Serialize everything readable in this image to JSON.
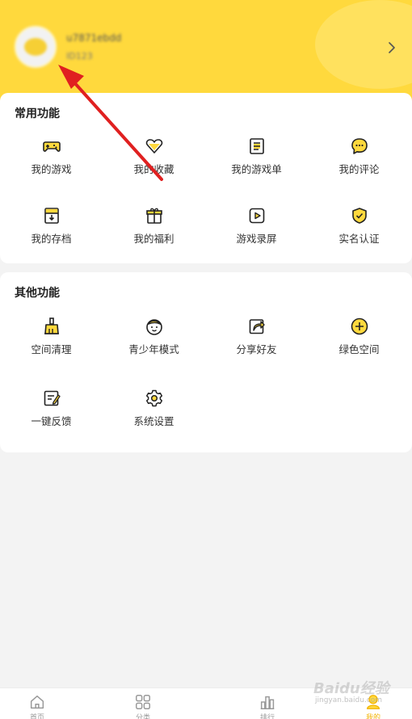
{
  "profile": {
    "username": "u7871ebdd",
    "sublabel": "ID123"
  },
  "sections": [
    {
      "title": "常用功能",
      "items": [
        {
          "label": "我的游戏",
          "icon": "gamepad-icon"
        },
        {
          "label": "我的收藏",
          "icon": "heart-icon"
        },
        {
          "label": "我的游戏单",
          "icon": "list-icon"
        },
        {
          "label": "我的评论",
          "icon": "comment-icon"
        },
        {
          "label": "我的存档",
          "icon": "archive-icon"
        },
        {
          "label": "我的福利",
          "icon": "gift-icon"
        },
        {
          "label": "游戏录屏",
          "icon": "record-icon"
        },
        {
          "label": "实名认证",
          "icon": "shield-check-icon"
        }
      ]
    },
    {
      "title": "其他功能",
      "items": [
        {
          "label": "空间清理",
          "icon": "broom-icon"
        },
        {
          "label": "青少年模式",
          "icon": "kid-face-icon"
        },
        {
          "label": "分享好友",
          "icon": "share-icon"
        },
        {
          "label": "绿色空间",
          "icon": "plus-circle-icon"
        },
        {
          "label": "一键反馈",
          "icon": "feedback-icon"
        },
        {
          "label": "系统设置",
          "icon": "gear-icon"
        }
      ]
    }
  ],
  "tabbar": [
    {
      "label": "首页",
      "icon": "home-icon",
      "active": false
    },
    {
      "label": "分类",
      "icon": "grid-icon",
      "active": false
    },
    {
      "label": "排行",
      "icon": "chart-icon",
      "active": false
    },
    {
      "label": "我的",
      "icon": "profile-icon",
      "active": true
    }
  ],
  "watermark": {
    "brand": "Baidu经验",
    "url": "jingyan.baidu.com"
  },
  "colors": {
    "accent": "#ffd93d",
    "active_tab": "#f3b300",
    "arrow": "#e02020"
  }
}
